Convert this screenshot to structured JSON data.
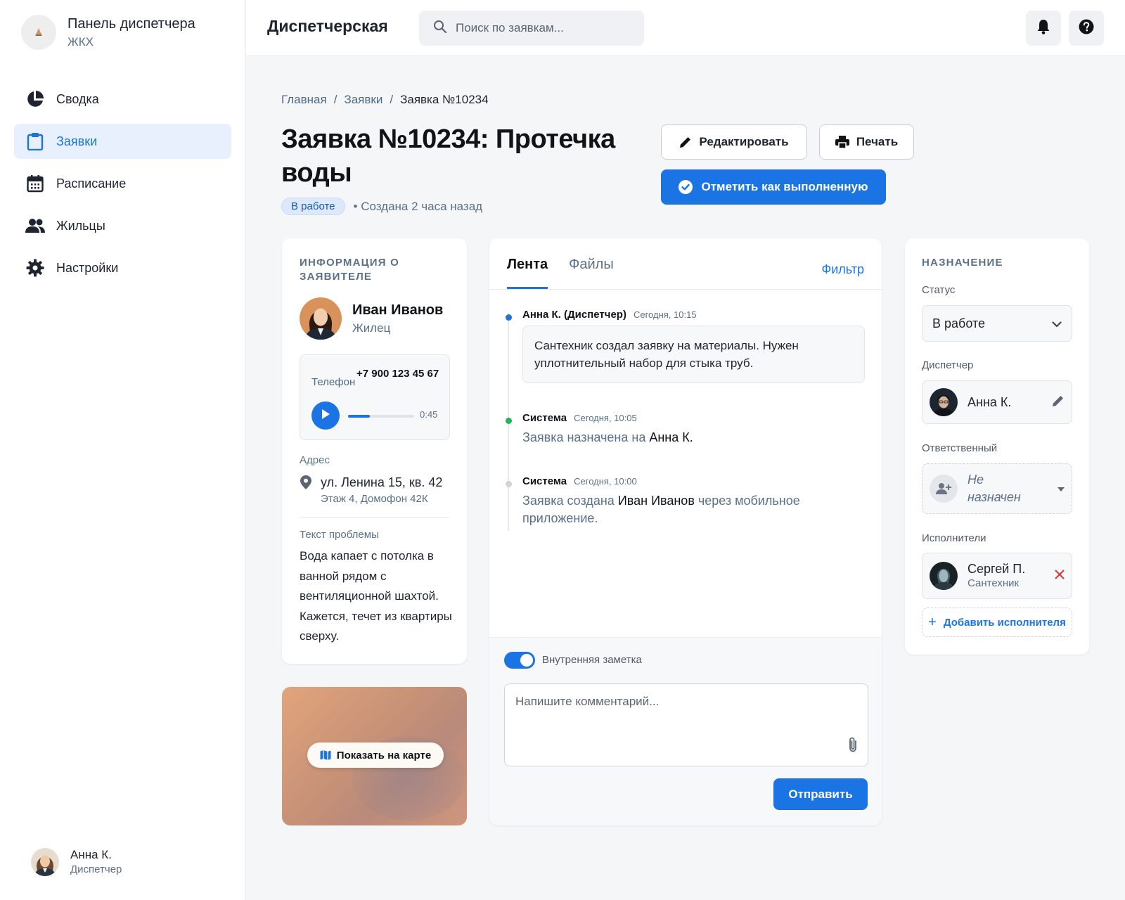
{
  "sidebar": {
    "brand_title": "Панель диспетчера",
    "brand_subtitle": "ЖКХ",
    "items": [
      {
        "label": "Сводка",
        "icon": "pie-chart-icon",
        "active": false
      },
      {
        "label": "Заявки",
        "icon": "clipboard-icon",
        "active": true
      },
      {
        "label": "Расписание",
        "icon": "calendar-icon",
        "active": false
      },
      {
        "label": "Жильцы",
        "icon": "people-icon",
        "active": false
      },
      {
        "label": "Настройки",
        "icon": "gear-icon",
        "active": false
      }
    ],
    "user": {
      "name": "Анна К.",
      "role": "Диспетчер"
    }
  },
  "header": {
    "title": "Диспетчерская",
    "search_placeholder": "Поиск по заявкам...",
    "icons": [
      "bell-icon",
      "help-icon"
    ]
  },
  "breadcrumb": {
    "home": "Главная",
    "section": "Заявки",
    "current": "Заявка №10234",
    "separator": "/"
  },
  "ticket": {
    "title": "Заявка №10234: Протечка воды",
    "status": "В работе",
    "created": "• Создана 2 часа назад",
    "edit_label": "Редактировать",
    "print_label": "Печать",
    "complete_label": "Отметить как выполненную"
  },
  "applicant": {
    "section_title": "ИНФОРМАЦИЯ О ЗАЯВИТЕЛЕ",
    "name": "Иван Иванов",
    "role": "Жилец",
    "phone_label": "Телефон",
    "phone": "+7 900 123 45 67",
    "audio_duration": "0:45",
    "audio_progress": 0.33,
    "address_label": "Адрес",
    "address": "ул. Ленина 15, кв. 42",
    "address_details": "Этаж 4, Домофон 42К",
    "problem_label": "Текст проблемы",
    "problem_text": "Вода капает с потолка в ванной рядом с вентиляционной шахтой. Кажется, течет из квартиры сверху.",
    "map_button": "Показать на карте"
  },
  "feed": {
    "tabs": [
      "Лента",
      "Файлы"
    ],
    "filter_label": "Фильтр",
    "events": [
      {
        "author": "Анна К. (Диспетчер)",
        "time": "Сегодня, 10:15",
        "text": "Сантехник создал заявку на материалы. Нужен уплотнительный набор для стыка труб.",
        "dot_color": "#1b74e4"
      },
      {
        "author": "Система",
        "time": "Сегодня, 10:05",
        "text_a": "Заявка назначена на ",
        "text_b": "Анна К.",
        "text_c": "",
        "dot_color": "#22b45a"
      },
      {
        "author": "Система",
        "time": "Сегодня, 10:00",
        "text_a": "Заявка создана ",
        "text_b": "Иван Иванов",
        "text_c": " через мобильное приложение.",
        "dot_color": "#cfd4da"
      }
    ],
    "internal_note_label": "Внутренняя заметка",
    "internal_note_on": true,
    "comment_placeholder": "Напишите комментарий...",
    "send_label": "Отправить"
  },
  "assignment": {
    "section_title": "НАЗНАЧЕНИЕ",
    "status_label": "Статус",
    "status_value": "В работе",
    "dispatcher_label": "Диспетчер",
    "dispatcher_name": "Анна К.",
    "responsible_label": "Ответственный",
    "responsible_value": "Не назначен",
    "executors_label": "Исполнители",
    "executor_name": "Сергей П.",
    "executor_role": "Сантехник",
    "add_executor_label": "Добавить исполнителя"
  },
  "colors": {
    "accent": "#1b74e4",
    "active_nav_bg": "#e7f0fc",
    "badge_bg": "#dde9fa",
    "remove": "#e0362c"
  }
}
